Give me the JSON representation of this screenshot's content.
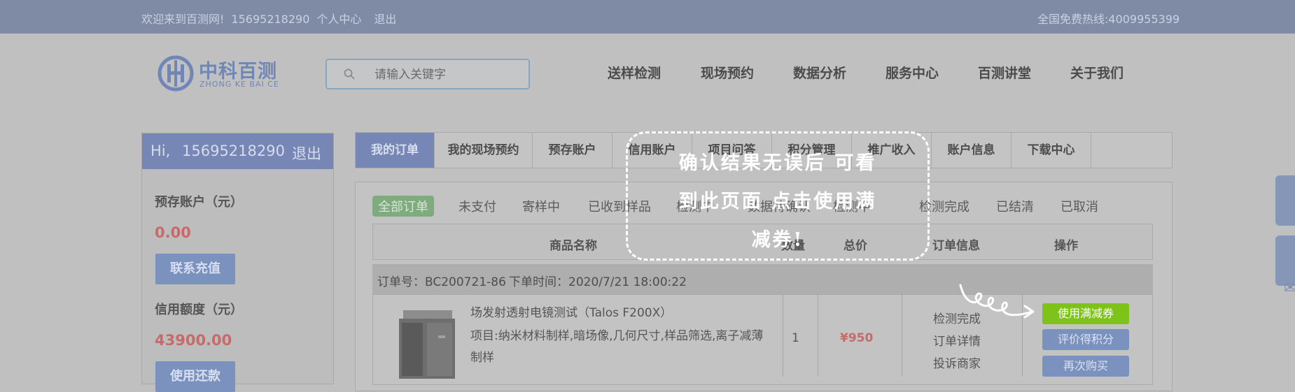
{
  "topbar": {
    "welcome": "欢迎来到百测网!",
    "phone": "15695218290",
    "personal_center": "个人中心",
    "logout": "退出",
    "hotline": "全国免费热线:4009955399"
  },
  "logo": {
    "cn": "中科百测",
    "en": "ZHONG KE BAI CE"
  },
  "search": {
    "placeholder": "请输入关键字",
    "icon": "search-icon"
  },
  "nav": [
    "送样检测",
    "现场预约",
    "数据分析",
    "服务中心",
    "百测讲堂",
    "关于我们"
  ],
  "sidebar": {
    "greeting": "Hi,",
    "phone": "15695218290",
    "logout": "退出",
    "prepaid_label": "预存账户（元）",
    "prepaid_value": "0.00",
    "recharge_button": "联系充值",
    "credit_label": "信用额度（元）",
    "credit_value": "43900.00",
    "repay_button": "使用还款"
  },
  "tabs": [
    "我的订单",
    "我的现场预约",
    "预存账户",
    "信用账户",
    "项目问答",
    "积分管理",
    "推广收入",
    "账户信息",
    "下载中心"
  ],
  "status_filters": [
    "全部订单",
    "未支付",
    "寄样中",
    "已收到样品",
    "检测中",
    "数据待确认",
    "检测中",
    "检测完成",
    "已结清",
    "已取消"
  ],
  "table_headers": {
    "name": "商品名称",
    "qty": "数量",
    "total": "总价",
    "info": "订单信息",
    "ops": "操作"
  },
  "order": {
    "order_no": "订单号：BC200721-86",
    "order_time": "下单时间：2020/7/21 18:00:22",
    "product_title": "场发射透射电镜测试（Talos F200X）",
    "product_desc_line1": "项目:纳米材料制样,暗场像,几何尺寸,样品筛选,离子减薄",
    "product_desc_line2": "制样",
    "quantity": "1",
    "price": "¥950",
    "status": "检测完成",
    "detail_link": "订单详情",
    "complain_link": "投诉商家",
    "use_coupon": "使用满减券",
    "rate_button": "评价得积分",
    "rebuy_button": "再次购买"
  },
  "overlay": {
    "line1": "确认结果无误后 可看",
    "line2": "到此页面 点击使用满",
    "line3": "减券!"
  },
  "colors": {
    "topbar": "#7f8ba5",
    "accent": "#7787b5",
    "green_button": "#7dc31a",
    "price_red": "#c96a6a"
  }
}
